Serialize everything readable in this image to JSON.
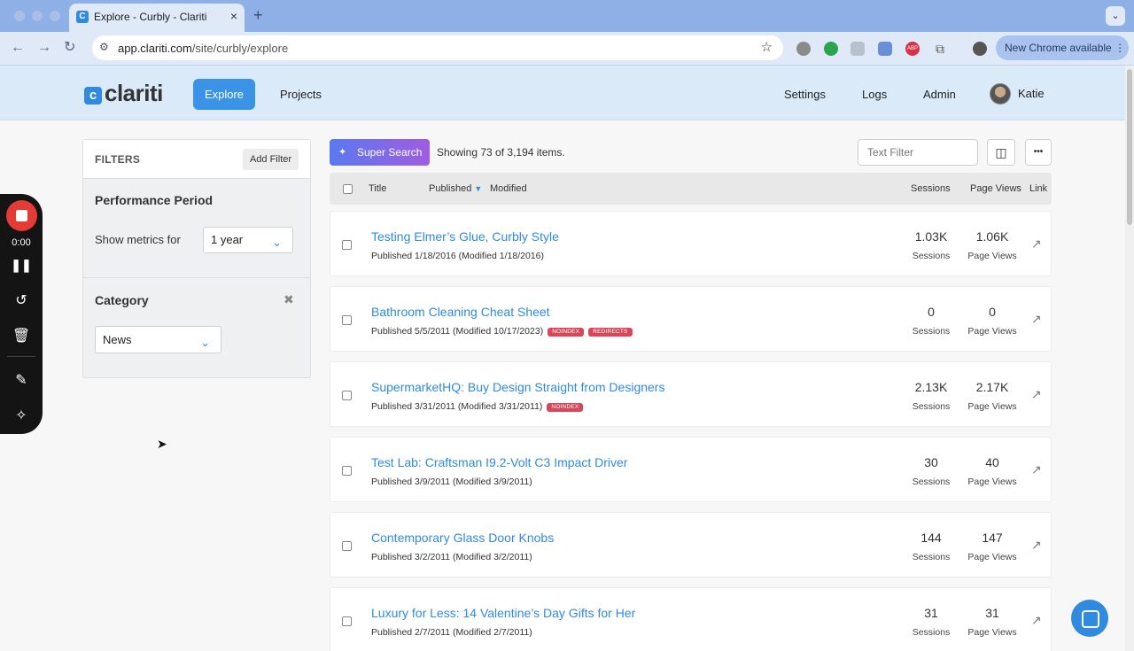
{
  "browser": {
    "tab_title": "Explore - Curbly - Clariti",
    "tab_close": "×",
    "new_tab": "+",
    "url_host": "app.clariti.com",
    "url_path": "/site/curbly/explore",
    "new_chrome": "New Chrome available",
    "ext_abp": "ABP"
  },
  "header": {
    "logo_mark": "c",
    "logo_text": "clariti",
    "nav": {
      "explore": "Explore",
      "projects": "Projects",
      "settings": "Settings",
      "logs": "Logs",
      "admin": "Admin",
      "user": "Katie"
    }
  },
  "filters": {
    "title": "FILTERS",
    "add_filter": "Add Filter",
    "performance": {
      "title": "Performance Period",
      "label": "Show metrics for",
      "value": "1 year"
    },
    "category": {
      "title": "Category",
      "value": "News"
    }
  },
  "recorder": {
    "time": "0:00"
  },
  "toolbar": {
    "super_search": "Super Search",
    "showing": "Showing 73 of 3,194 items.",
    "text_filter_placeholder": "Text Filter",
    "more": "•••"
  },
  "table": {
    "headers": {
      "title": "Title",
      "published": "Published",
      "modified": "Modified",
      "sessions": "Sessions",
      "page_views": "Page Views",
      "link": "Link"
    },
    "rows": [
      {
        "title": "Testing Elmer’s Glue, Curbly Style",
        "meta": "Published 1/18/2016 (Modified 1/18/2016)",
        "badges": [],
        "sessions": "1.03K",
        "page_views": "1.06K",
        "sessions_label": "Sessions",
        "page_views_label": "Page Views"
      },
      {
        "title": "Bathroom Cleaning Cheat Sheet",
        "meta": "Published 5/5/2011 (Modified 10/17/2023)",
        "badges": [
          "NOINDEX",
          "REDIRECTS"
        ],
        "sessions": "0",
        "page_views": "0",
        "sessions_label": "Sessions",
        "page_views_label": "Page Views"
      },
      {
        "title": "SupermarketHQ: Buy Design Straight from Designers",
        "meta": "Published 3/31/2011 (Modified 3/31/2011)",
        "badges": [
          "NOINDEX"
        ],
        "sessions": "2.13K",
        "page_views": "2.17K",
        "sessions_label": "Sessions",
        "page_views_label": "Page Views"
      },
      {
        "title": "Test Lab: Craftsman I9.2-Volt C3 Impact Driver",
        "meta": "Published 3/9/2011 (Modified 3/9/2011)",
        "badges": [],
        "sessions": "30",
        "page_views": "40",
        "sessions_label": "Sessions",
        "page_views_label": "Page Views"
      },
      {
        "title": "Contemporary Glass Door Knobs",
        "meta": "Published 3/2/2011 (Modified 3/2/2011)",
        "badges": [],
        "sessions": "144",
        "page_views": "147",
        "sessions_label": "Sessions",
        "page_views_label": "Page Views"
      },
      {
        "title": "Luxury for Less: 14 Valentine’s Day Gifts for Her",
        "meta": "Published 2/7/2011 (Modified 2/7/2011)",
        "badges": [],
        "sessions": "31",
        "page_views": "31",
        "sessions_label": "Sessions",
        "page_views_label": "Page Views"
      }
    ]
  },
  "colors": {
    "accent": "#2f8ae0",
    "badge": "#d9465a",
    "record": "#e53b35"
  }
}
